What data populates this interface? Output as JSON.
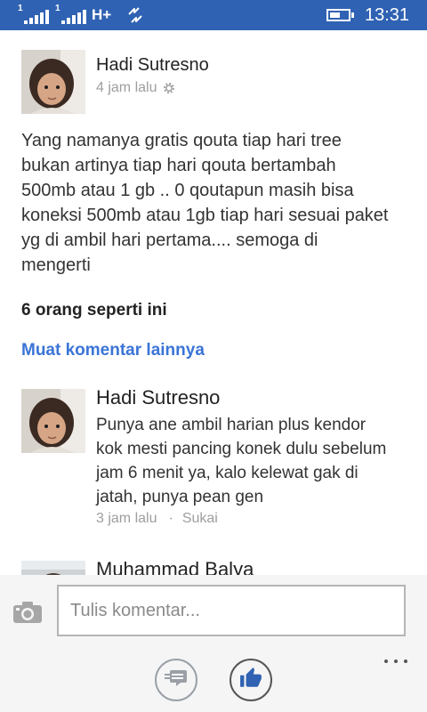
{
  "theme": {
    "accent": "#2f62b3",
    "link": "#3a74d6",
    "text": "#2b2b2b",
    "muted": "#9e9e9e"
  },
  "status_bar": {
    "sim1_label": "1",
    "sim2_label": "1",
    "network_type": "H+",
    "time": "13:31",
    "battery_level": 0.6,
    "icons": [
      "signal-icon",
      "signal-icon",
      "data-transfer-icon",
      "battery-icon"
    ]
  },
  "post": {
    "author": "Hadi Sutresno",
    "time": "4 jam lalu",
    "options_icon": "gear-icon",
    "body_lines": [
      "Yang namanya gratis qouta tiap hari tree",
      "bukan artinya tiap hari qouta bertambah",
      "500mb atau 1 gb .. 0 qoutapun masih bisa",
      "koneksi 500mb atau 1gb tiap hari sesuai paket",
      "yg di ambil hari pertama.... semoga di",
      "mengerti"
    ],
    "likes_summary": "6 orang seperti ini"
  },
  "load_more_comments": "Muat komentar lainnya",
  "comments": [
    {
      "author": "Hadi Sutresno",
      "lines": [
        "Punya ane ambil harian plus kendor",
        "kok mesti pancing konek dulu sebelum",
        "jam 6 menit ya, kalo kelewat gak di",
        "jatah, punya pean gen"
      ],
      "time": "3 jam lalu",
      "separator": "·",
      "like_label": "Sukai"
    },
    {
      "author": "Muhammad Balya"
    }
  ],
  "composer": {
    "camera_icon": "camera-icon",
    "placeholder": "Tulis komentar..."
  },
  "app_bar": {
    "buttons": [
      {
        "icon": "comment-icon"
      },
      {
        "icon": "thumbs-up-icon",
        "active": true
      }
    ],
    "more_icon": "more-icon"
  }
}
